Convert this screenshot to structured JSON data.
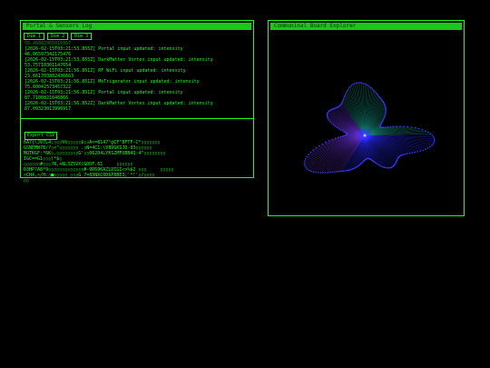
{
  "portal": {
    "title": "Portal & Sensors Log",
    "tabs": [
      "Dim 1",
      "Dim 2",
      "Dim 3"
    ],
    "log_cut": "58.46802965016867",
    "log": [
      "[2026-02-15T03:21:53.855Z] Portal input updated: intensity",
      "46.06597342175476",
      "[2026-02-15T03:21:53.855Z] DarkMatter Vortex input updated: intensity",
      "53.75710301147654",
      "[2026-02-15T03:21:56.851Z] RF WiFi input updated: intensity",
      "23.661703802436663",
      "[2026-02-15T03:21:56.851Z] MoTrigerator input updated: intensity",
      "75.60042573457322",
      "[2026-02-15T03:21:56.851Z] Portal input updated: intensity",
      "87.7100821646866",
      "[2026-02-15T03:21:56.852Z] DarkMatter Vortex input updated: intensity",
      "87.09323013996917"
    ],
    "export_label": "Export CSV",
    "noise": [
      "6A7{\\JO7L4;▯▯▯%%▯▯▯▯▯$▯▯A<=8147¹@CF\"8FTF-C*▯▯▯▯▯▯▯",
      "GSNEMW7B/?▯<\"▯▯▯▯▯▯▯ .▯N=4C1:\\V8DGKSJ0-93▯▯▯▯▯▯",
      "MQTKGF:*6K▯.▯▯▯▯▯▯▯▯G'▯▯06204LYKSZMFUBB4Q:4\"▯▯▯▯▯▯▯▯",
      "IGC==G1▯▯▯)*$▯",
      "▯▯▯▯▯▯#▯▯▯?N,+NL3Z5VX(GDDF.61     ▯▯▯▯▯▯",
      "D3HP?A8*9▯▯▯▯▯▯▯▯▯▯▯▯▯#-9R69KAZLDIGI<>%$2 ▯▯▯     ▯▯▯▯▯",
      "<CH4,>/H:▯■▯▯▯▯▯ ▯▯▯G 7=83NXC0D6P8BE3;'*!'▯/▯▯▯▯",
      "▯▯"
    ]
  },
  "board": {
    "title": "Communinal Board Explorer"
  }
}
